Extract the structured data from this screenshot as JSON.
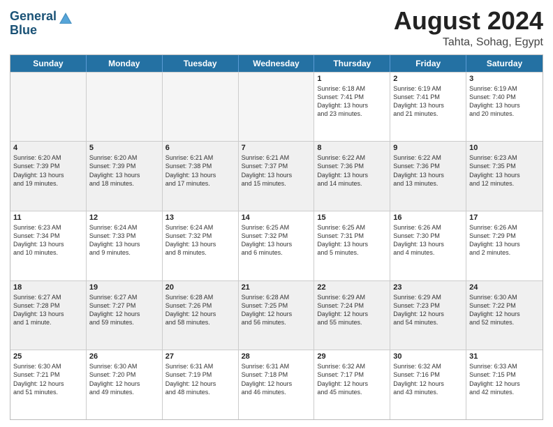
{
  "header": {
    "logo_line1": "General",
    "logo_line2": "Blue",
    "title": "August 2024",
    "location": "Tahta, Sohag, Egypt"
  },
  "weekdays": [
    "Sunday",
    "Monday",
    "Tuesday",
    "Wednesday",
    "Thursday",
    "Friday",
    "Saturday"
  ],
  "weeks": [
    [
      {
        "day": "",
        "info": "",
        "empty": true
      },
      {
        "day": "",
        "info": "",
        "empty": true
      },
      {
        "day": "",
        "info": "",
        "empty": true
      },
      {
        "day": "",
        "info": "",
        "empty": true
      },
      {
        "day": "1",
        "info": "Sunrise: 6:18 AM\nSunset: 7:41 PM\nDaylight: 13 hours\nand 23 minutes.",
        "empty": false
      },
      {
        "day": "2",
        "info": "Sunrise: 6:19 AM\nSunset: 7:41 PM\nDaylight: 13 hours\nand 21 minutes.",
        "empty": false
      },
      {
        "day": "3",
        "info": "Sunrise: 6:19 AM\nSunset: 7:40 PM\nDaylight: 13 hours\nand 20 minutes.",
        "empty": false
      }
    ],
    [
      {
        "day": "4",
        "info": "Sunrise: 6:20 AM\nSunset: 7:39 PM\nDaylight: 13 hours\nand 19 minutes.",
        "empty": false
      },
      {
        "day": "5",
        "info": "Sunrise: 6:20 AM\nSunset: 7:39 PM\nDaylight: 13 hours\nand 18 minutes.",
        "empty": false
      },
      {
        "day": "6",
        "info": "Sunrise: 6:21 AM\nSunset: 7:38 PM\nDaylight: 13 hours\nand 17 minutes.",
        "empty": false
      },
      {
        "day": "7",
        "info": "Sunrise: 6:21 AM\nSunset: 7:37 PM\nDaylight: 13 hours\nand 15 minutes.",
        "empty": false
      },
      {
        "day": "8",
        "info": "Sunrise: 6:22 AM\nSunset: 7:36 PM\nDaylight: 13 hours\nand 14 minutes.",
        "empty": false
      },
      {
        "day": "9",
        "info": "Sunrise: 6:22 AM\nSunset: 7:36 PM\nDaylight: 13 hours\nand 13 minutes.",
        "empty": false
      },
      {
        "day": "10",
        "info": "Sunrise: 6:23 AM\nSunset: 7:35 PM\nDaylight: 13 hours\nand 12 minutes.",
        "empty": false
      }
    ],
    [
      {
        "day": "11",
        "info": "Sunrise: 6:23 AM\nSunset: 7:34 PM\nDaylight: 13 hours\nand 10 minutes.",
        "empty": false
      },
      {
        "day": "12",
        "info": "Sunrise: 6:24 AM\nSunset: 7:33 PM\nDaylight: 13 hours\nand 9 minutes.",
        "empty": false
      },
      {
        "day": "13",
        "info": "Sunrise: 6:24 AM\nSunset: 7:32 PM\nDaylight: 13 hours\nand 8 minutes.",
        "empty": false
      },
      {
        "day": "14",
        "info": "Sunrise: 6:25 AM\nSunset: 7:32 PM\nDaylight: 13 hours\nand 6 minutes.",
        "empty": false
      },
      {
        "day": "15",
        "info": "Sunrise: 6:25 AM\nSunset: 7:31 PM\nDaylight: 13 hours\nand 5 minutes.",
        "empty": false
      },
      {
        "day": "16",
        "info": "Sunrise: 6:26 AM\nSunset: 7:30 PM\nDaylight: 13 hours\nand 4 minutes.",
        "empty": false
      },
      {
        "day": "17",
        "info": "Sunrise: 6:26 AM\nSunset: 7:29 PM\nDaylight: 13 hours\nand 2 minutes.",
        "empty": false
      }
    ],
    [
      {
        "day": "18",
        "info": "Sunrise: 6:27 AM\nSunset: 7:28 PM\nDaylight: 13 hours\nand 1 minute.",
        "empty": false
      },
      {
        "day": "19",
        "info": "Sunrise: 6:27 AM\nSunset: 7:27 PM\nDaylight: 12 hours\nand 59 minutes.",
        "empty": false
      },
      {
        "day": "20",
        "info": "Sunrise: 6:28 AM\nSunset: 7:26 PM\nDaylight: 12 hours\nand 58 minutes.",
        "empty": false
      },
      {
        "day": "21",
        "info": "Sunrise: 6:28 AM\nSunset: 7:25 PM\nDaylight: 12 hours\nand 56 minutes.",
        "empty": false
      },
      {
        "day": "22",
        "info": "Sunrise: 6:29 AM\nSunset: 7:24 PM\nDaylight: 12 hours\nand 55 minutes.",
        "empty": false
      },
      {
        "day": "23",
        "info": "Sunrise: 6:29 AM\nSunset: 7:23 PM\nDaylight: 12 hours\nand 54 minutes.",
        "empty": false
      },
      {
        "day": "24",
        "info": "Sunrise: 6:30 AM\nSunset: 7:22 PM\nDaylight: 12 hours\nand 52 minutes.",
        "empty": false
      }
    ],
    [
      {
        "day": "25",
        "info": "Sunrise: 6:30 AM\nSunset: 7:21 PM\nDaylight: 12 hours\nand 51 minutes.",
        "empty": false
      },
      {
        "day": "26",
        "info": "Sunrise: 6:30 AM\nSunset: 7:20 PM\nDaylight: 12 hours\nand 49 minutes.",
        "empty": false
      },
      {
        "day": "27",
        "info": "Sunrise: 6:31 AM\nSunset: 7:19 PM\nDaylight: 12 hours\nand 48 minutes.",
        "empty": false
      },
      {
        "day": "28",
        "info": "Sunrise: 6:31 AM\nSunset: 7:18 PM\nDaylight: 12 hours\nand 46 minutes.",
        "empty": false
      },
      {
        "day": "29",
        "info": "Sunrise: 6:32 AM\nSunset: 7:17 PM\nDaylight: 12 hours\nand 45 minutes.",
        "empty": false
      },
      {
        "day": "30",
        "info": "Sunrise: 6:32 AM\nSunset: 7:16 PM\nDaylight: 12 hours\nand 43 minutes.",
        "empty": false
      },
      {
        "day": "31",
        "info": "Sunrise: 6:33 AM\nSunset: 7:15 PM\nDaylight: 12 hours\nand 42 minutes.",
        "empty": false
      }
    ]
  ]
}
